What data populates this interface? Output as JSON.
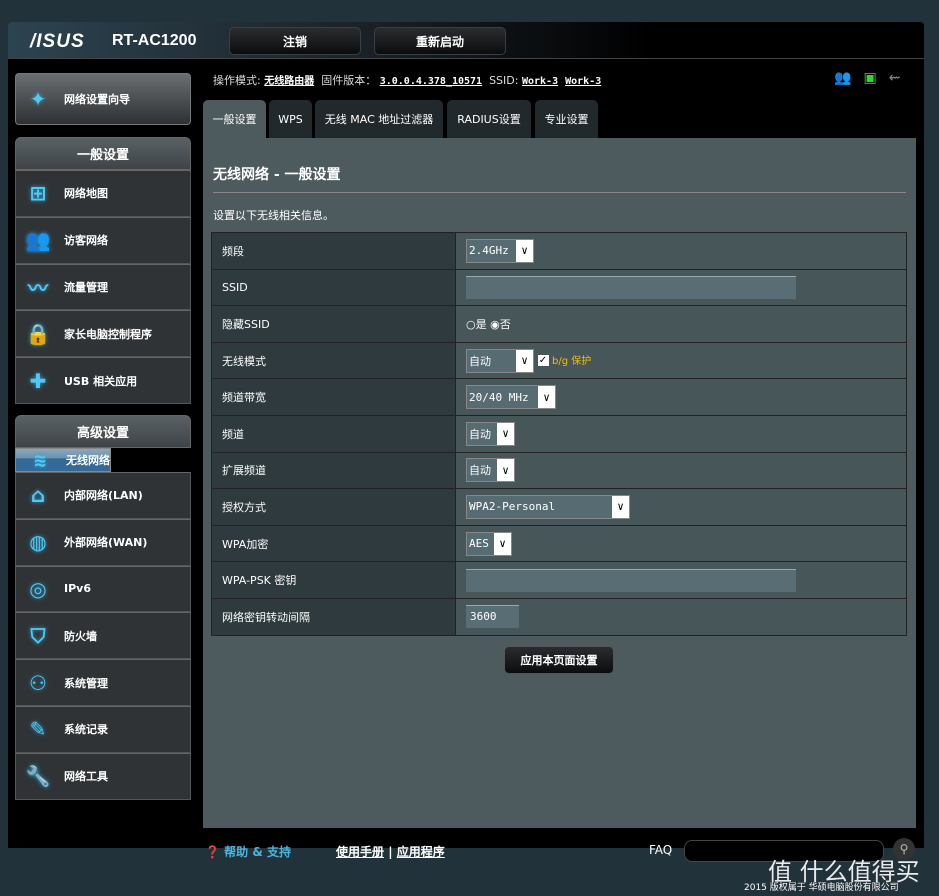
{
  "header": {
    "logo": "/ISUS",
    "model": "RT-AC1200",
    "logout": "注销",
    "reboot": "重新启动"
  },
  "status": {
    "mode_label": "操作模式:",
    "mode": "无线路由器",
    "fw_label": "固件版本：",
    "fw": "3.0.0.4.378_10571",
    "ssid_label": "SSID:",
    "ssid1": "Work-3",
    "ssid2": "Work-3",
    "icons": [
      "clients-icon",
      "network-status-icon",
      "usb-icon"
    ]
  },
  "sidebar": {
    "wizard": "网络设置向导",
    "general_title": "一般设置",
    "general": [
      {
        "label": "网络地图",
        "icon": "network-map-icon"
      },
      {
        "label": "访客网络",
        "icon": "guest-network-icon"
      },
      {
        "label": "流量管理",
        "icon": "traffic-icon"
      },
      {
        "label": "家长电脑控制程序",
        "icon": "lock-icon"
      },
      {
        "label": "USB 相关应用",
        "icon": "puzzle-icon"
      }
    ],
    "advanced_title": "高级设置",
    "advanced": [
      {
        "label": "无线网络",
        "icon": "wifi-icon"
      },
      {
        "label": "内部网络(LAN)",
        "icon": "home-icon"
      },
      {
        "label": "外部网络(WAN)",
        "icon": "globe-icon"
      },
      {
        "label": "IPv6",
        "icon": "ipv6-icon"
      },
      {
        "label": "防火墙",
        "icon": "shield-icon"
      },
      {
        "label": "系统管理",
        "icon": "user-icon"
      },
      {
        "label": "系统记录",
        "icon": "log-icon"
      },
      {
        "label": "网络工具",
        "icon": "tools-icon"
      }
    ]
  },
  "tabs": [
    "一般设置",
    "WPS",
    "无线 MAC 地址过滤器",
    "RADIUS设置",
    "专业设置"
  ],
  "main": {
    "title": "无线网络 - 一般设置",
    "desc": "设置以下无线相关信息。",
    "rows": {
      "band": {
        "label": "频段",
        "value": "2.4GHz"
      },
      "ssid": {
        "label": "SSID",
        "value": ""
      },
      "hide": {
        "label": "隐藏SSID",
        "yes": "是",
        "no": "否",
        "selected": "否"
      },
      "mode": {
        "label": "无线模式",
        "value": "自动",
        "bg": "b/g 保护",
        "bg_checked": true
      },
      "bw": {
        "label": "频道带宽",
        "value": "20/40 MHz"
      },
      "ch": {
        "label": "频道",
        "value": "自动"
      },
      "ext": {
        "label": "扩展频道",
        "value": "自动"
      },
      "auth": {
        "label": "授权方式",
        "value": "WPA2-Personal"
      },
      "enc": {
        "label": "WPA加密",
        "value": "AES"
      },
      "psk": {
        "label": "WPA-PSK 密钥",
        "value": ""
      },
      "rot": {
        "label": "网络密钥转动间隔",
        "value": "3600"
      }
    },
    "apply": "应用本页面设置"
  },
  "footer": {
    "help": "帮助 & 支持",
    "manual": "使用手册",
    "sep": "|",
    "apps": "应用程序",
    "faq": "FAQ",
    "copyright": "2015 版权属于 华硕电脑股份有限公司",
    "watermark": "值 什么值得买"
  },
  "colors": {
    "accent": "#55c8f2",
    "selected": "#336a98",
    "bg_protect": "#f0c000"
  }
}
